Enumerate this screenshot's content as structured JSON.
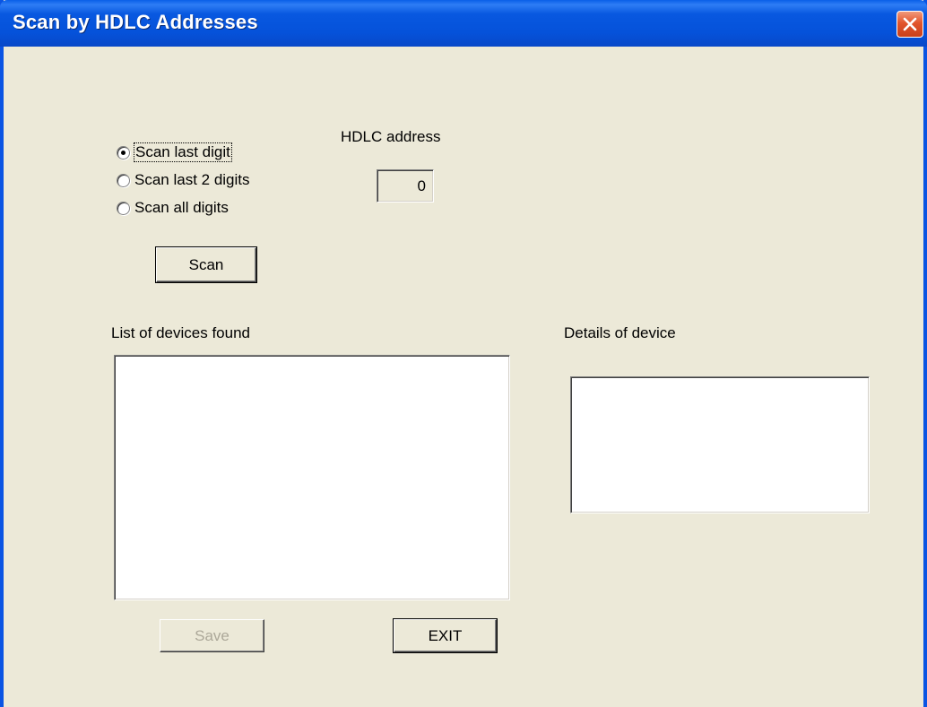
{
  "window": {
    "title": "Scan by HDLC Addresses"
  },
  "scan_options": {
    "items": [
      {
        "label": "Scan last digit",
        "checked": true
      },
      {
        "label": "Scan last 2 digits",
        "checked": false
      },
      {
        "label": "Scan all digits",
        "checked": false
      }
    ]
  },
  "hdlc": {
    "label": "HDLC address",
    "value": "0"
  },
  "buttons": {
    "scan": "Scan",
    "save": "Save",
    "exit": "EXIT"
  },
  "devices": {
    "label": "List of devices found",
    "items": []
  },
  "details": {
    "label": "Details of device",
    "text": ""
  },
  "colors": {
    "titlebar": "#0552DA",
    "dialog_bg": "#ECE9D8",
    "close_button": "#E2552C",
    "disabled_text": "#ACA899"
  }
}
